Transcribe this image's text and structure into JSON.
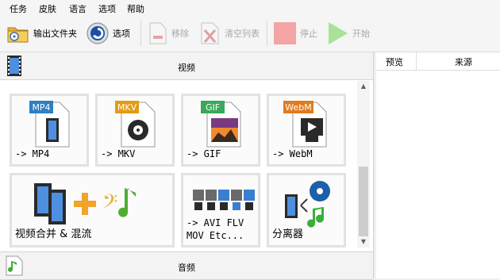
{
  "menu": {
    "task": "任务",
    "skin": "皮肤",
    "language": "语言",
    "options": "选项",
    "help": "帮助"
  },
  "toolbar": {
    "output_folder": "输出文件夹",
    "options": "选项",
    "remove": "移除",
    "clear_list": "清空列表",
    "stop": "停止",
    "start": "开始"
  },
  "sections": {
    "video": "视频",
    "audio": "音频"
  },
  "tiles": {
    "mp4": {
      "badge": "MP4",
      "label": "-> MP4"
    },
    "mkv": {
      "badge": "MKV",
      "label": "-> MKV"
    },
    "gif": {
      "badge": "GIF",
      "label": "-> GIF"
    },
    "webm": {
      "badge": "WebM",
      "label": "-> WebM"
    },
    "merge": {
      "label": "视频合并 & 混流"
    },
    "avi": {
      "label_line1": "-> AVI FLV",
      "label_line2": "MOV Etc..."
    },
    "splitter": {
      "label": "分离器"
    }
  },
  "table": {
    "preview": "预览",
    "source": "来源"
  },
  "colors": {
    "mp4_badge": "#2f7fc1",
    "mkv_badge": "#e49a17",
    "gif_badge": "#3aa85a",
    "webm_badge": "#e07b1f",
    "stop_red": "#f3a4a4",
    "start_green": "#a8e29a"
  }
}
